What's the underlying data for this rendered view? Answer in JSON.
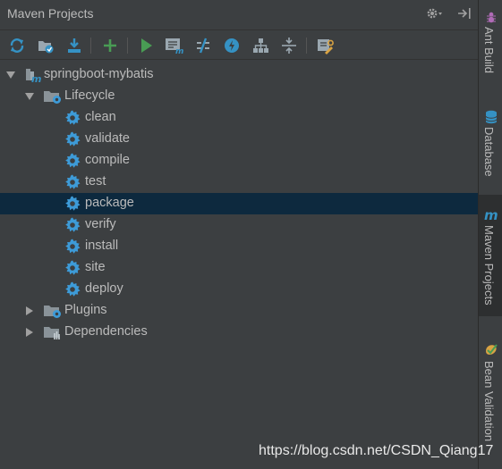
{
  "panel": {
    "title": "Maven Projects"
  },
  "toolbar": {
    "buttons": [
      {
        "name": "reimport-icon",
        "color": "#3592c4"
      },
      {
        "name": "generate-sources-icon",
        "color": "#3592c4"
      },
      {
        "name": "download-icon",
        "color": "#3592c4"
      },
      {
        "name": "add-icon",
        "color": "#499c54"
      },
      {
        "name": "run-icon",
        "color": "#499c54"
      },
      {
        "name": "execute-goal-icon",
        "color": "#9aa7b0"
      },
      {
        "name": "toggle-offline-icon",
        "color": "#3592c4"
      },
      {
        "name": "skip-tests-icon",
        "color": "#3592c4"
      },
      {
        "name": "show-dependencies-icon",
        "color": "#9aa7b0"
      },
      {
        "name": "collapse-all-icon",
        "color": "#9aa7b0"
      },
      {
        "name": "settings-icon",
        "color": "#d9a343"
      }
    ]
  },
  "tree": {
    "project": "springboot-mybatis",
    "lifecycle": "Lifecycle",
    "goals": [
      "clean",
      "validate",
      "compile",
      "test",
      "package",
      "verify",
      "install",
      "site",
      "deploy"
    ],
    "selected_goal": "package",
    "plugins": "Plugins",
    "dependencies": "Dependencies"
  },
  "sidebar": {
    "tabs": [
      {
        "label": "Ant Build",
        "icon": "ant-icon"
      },
      {
        "label": "Database",
        "icon": "database-icon"
      },
      {
        "label": "Maven Projects",
        "icon": "maven-icon",
        "active": true
      },
      {
        "label": "Bean Validation",
        "icon": "bean-validation-icon"
      }
    ]
  },
  "watermark": "https://blog.csdn.net/CSDN_Qiang17",
  "colors": {
    "background": "#3c3f41",
    "selection": "#0d293e",
    "gear": "#3d9bd8",
    "text": "#bbbbbb"
  }
}
